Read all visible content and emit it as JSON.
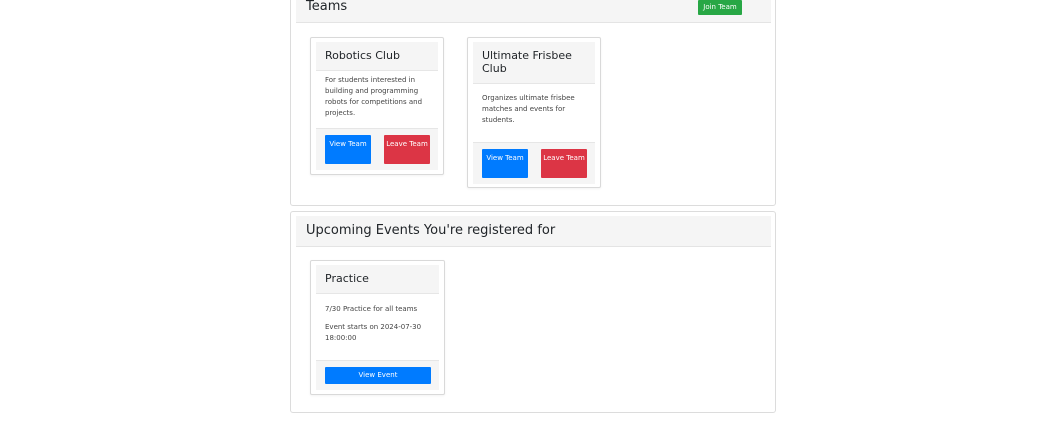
{
  "teams_section": {
    "title": "Teams",
    "join_label": "Join Team",
    "cards": [
      {
        "name": "Robotics Club",
        "description": "For students interested in building and programming robots for competitions and projects.",
        "view_label": "View Team",
        "leave_label": "Leave Team"
      },
      {
        "name": "Ultimate Frisbee Club",
        "description": "Organizes ultimate frisbee matches and events for students.",
        "view_label": "View Team",
        "leave_label": "Leave Team"
      }
    ]
  },
  "events_section": {
    "title": "Upcoming Events You're registered for",
    "cards": [
      {
        "name": "Practice",
        "description": "7/30 Practice for all teams",
        "start_text": "Event starts on 2024-07-30 18:00:00",
        "view_label": "View Event"
      }
    ]
  },
  "colors": {
    "primary": "#007bff",
    "danger": "#dc3545",
    "success": "#28a745"
  }
}
